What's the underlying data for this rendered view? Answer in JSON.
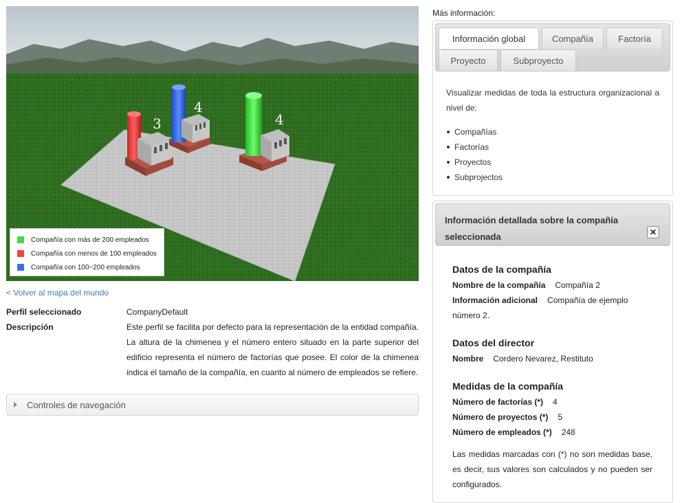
{
  "scene": {
    "legend": [
      {
        "label": "Compañía con más de 200 empleados",
        "color": "#3dde3d"
      },
      {
        "label": "Compañía con menos de 100 empleados",
        "color": "#f24444"
      },
      {
        "label": "Compañía con 100~200 empleados",
        "color": "#3a6ff0"
      }
    ],
    "buildings": [
      {
        "count": "3",
        "chimney_color": "#f24444"
      },
      {
        "count": "4",
        "chimney_color": "#3a6ff0"
      },
      {
        "count": "4",
        "chimney_color": "#3dde3d"
      }
    ]
  },
  "left": {
    "back_link": "< Volver al mapa del mundo",
    "profile_key": "Perfil seleccionado",
    "profile_value": "CompanyDefault",
    "description_key": "Descripción",
    "description_value": "Este perfil se facilita por defecto para la representación de la entidad compañía. La altura de la chimenea y el número entero situado en la parte superior del edificio representa el número de factorías que posee. El color de la chimenea indica el tamaño de la compañía, en cuanto al número de empleados se refiere.",
    "nav_controls": "Controles de navegación"
  },
  "right": {
    "mas_info": "Más información:",
    "tabs": [
      {
        "label": "Información global",
        "active": true
      },
      {
        "label": "Compañía"
      },
      {
        "label": "Factoría"
      },
      {
        "label": "Proyecto"
      },
      {
        "label": "Subproyecto"
      }
    ],
    "tab_content": {
      "description": "Visualizar medidas de toda la estructura organizacional a nivel de:",
      "items": [
        "Compañías",
        "Factorías",
        "Proyectos",
        "Subprojectos"
      ]
    },
    "detail": {
      "title": "Información detallada sobre la compañía seleccionada",
      "close": "✕",
      "company_section": "Datos de la compañía",
      "company_name_key": "Nombre de la compañía",
      "company_name_value": "Compañía 2",
      "additional_key": "Información adicional",
      "additional_value": "Compañía de ejemplo número 2.",
      "director_section": "Datos del director",
      "director_name_key": "Nombre",
      "director_name_value": "Cordero Nevarez, Restituto",
      "measures_section": "Medidas de la compañía",
      "factories_key": "Número de factorías (*)",
      "factories_value": "4",
      "projects_key": "Número de proyectos (*)",
      "projects_value": "5",
      "employees_key": "Número de empleados (*)",
      "employees_value": "248",
      "note": "Las medidas marcadas con (*) no son medidas base, es decir, sus valores son calculados y no pueden ser configurados."
    }
  }
}
